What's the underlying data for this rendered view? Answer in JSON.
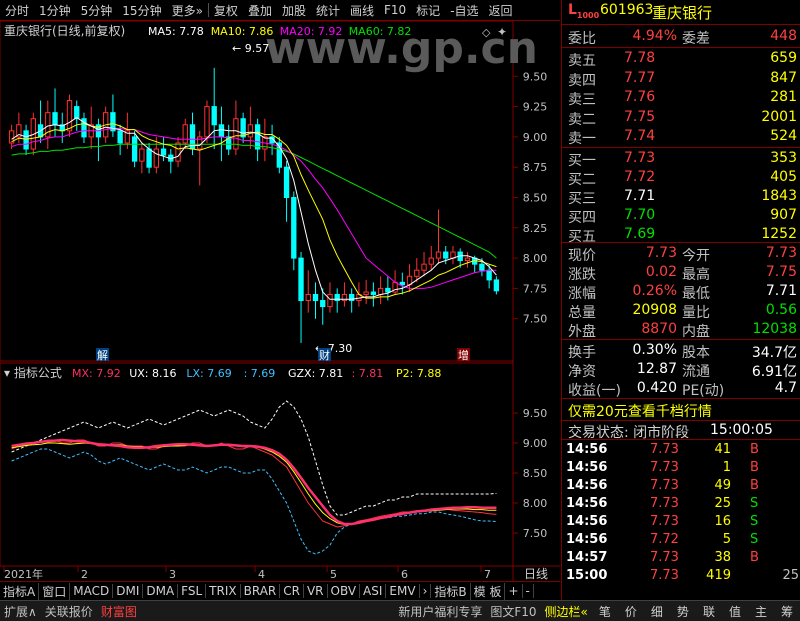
{
  "toolbar": {
    "items": [
      "分时",
      "1分钟",
      "5分钟",
      "15分钟",
      "更多»",
      "复权",
      "叠加",
      "加股",
      "统计",
      "画线",
      "F10",
      "标记",
      "-自选",
      "返回"
    ]
  },
  "main_legend": {
    "title": "重庆银行(日线,前复权)",
    "items": [
      {
        "label": "MA5: 7.78",
        "color": "#ffffff"
      },
      {
        "label": "MA10: 7.86",
        "color": "#ffff00"
      },
      {
        "label": "MA20: 7.92",
        "color": "#ff00ff"
      },
      {
        "label": "MA60: 7.82",
        "color": "#00e000"
      }
    ],
    "watermark": "www.gp.cn"
  },
  "main_axis": {
    "ticks": [
      "9.50",
      "9.25",
      "9.00",
      "8.75",
      "8.50",
      "8.25",
      "8.00",
      "7.75",
      "7.50"
    ]
  },
  "annotations": {
    "high": "9.57",
    "low": "7.30",
    "tag_jie": "解",
    "tag_cai": "财",
    "tag_zeng": "增"
  },
  "indicator_legend": {
    "title": "指标公式",
    "items": [
      {
        "label": "MX: 7.92",
        "color": "#ff3060"
      },
      {
        "label": "UX: 8.16",
        "color": "#ffffff"
      },
      {
        "label": "LX: 7.69",
        "color": "#40c0ff"
      },
      {
        "label": ": 7.69",
        "color": "#40c0ff"
      },
      {
        "label": "GZX: 7.81",
        "color": "#ffffff"
      },
      {
        "label": ": 7.81",
        "color": "#ff3060"
      },
      {
        "label": "P2: 7.88",
        "color": "#ffff00"
      }
    ]
  },
  "ind_axis": {
    "ticks": [
      "9.50",
      "9.00",
      "8.50",
      "8.00",
      "7.50"
    ]
  },
  "date_axis": {
    "labels": [
      "2021年",
      "2",
      "3",
      "4",
      "5",
      "6",
      "7"
    ],
    "right": "日线"
  },
  "tabs": [
    "指标A",
    "窗口",
    "MACD",
    "DMI",
    "DMA",
    "FSL",
    "TRIX",
    "BRAR",
    "CR",
    "VR",
    "OBV",
    "ASI",
    "EMV",
    "›",
    "指标B",
    "模 板",
    "+",
    "-"
  ],
  "bottom": {
    "left": [
      {
        "t": "扩展∧",
        "c": "#c0c0c0"
      },
      {
        "t": "关联报价",
        "c": "#c0c0c0"
      },
      {
        "t": "财富图",
        "c": "#ff4040"
      }
    ],
    "mid": [
      {
        "t": "新用户福利专享",
        "c": "#c0c0c0"
      },
      {
        "t": "图文F10",
        "c": "#c0c0c0"
      },
      {
        "t": "侧边栏«",
        "c": "#ffff00"
      }
    ],
    "right": [
      "笔",
      "价",
      "细",
      "势",
      "联",
      "值",
      "主",
      "筹"
    ]
  },
  "quote": {
    "code": "601963",
    "name": "重庆银行",
    "mark": "L",
    "mark_sub": "1000",
    "webi_label": "委比",
    "webi": "4.94%",
    "weicha_label": "委差",
    "weicha": "448",
    "sells": [
      {
        "label": "卖五",
        "price": "7.78",
        "vol": "659"
      },
      {
        "label": "卖四",
        "price": "7.77",
        "vol": "847"
      },
      {
        "label": "卖三",
        "price": "7.76",
        "vol": "281"
      },
      {
        "label": "卖二",
        "price": "7.75",
        "vol": "2001"
      },
      {
        "label": "卖一",
        "price": "7.74",
        "vol": "524"
      }
    ],
    "buys": [
      {
        "label": "买一",
        "price": "7.73",
        "vol": "353",
        "pc": "#ff4040"
      },
      {
        "label": "买二",
        "price": "7.72",
        "vol": "405",
        "pc": "#ff4040"
      },
      {
        "label": "买三",
        "price": "7.71",
        "vol": "1843",
        "pc": "#ffffff"
      },
      {
        "label": "买四",
        "price": "7.70",
        "vol": "907",
        "pc": "#00e000"
      },
      {
        "label": "买五",
        "price": "7.69",
        "vol": "1252",
        "pc": "#00e000"
      }
    ],
    "stats": [
      {
        "l1": "现价",
        "v1": "7.73",
        "c1": "#ff4040",
        "l2": "今开",
        "v2": "7.73",
        "c2": "#ff4040"
      },
      {
        "l1": "涨跌",
        "v1": "0.02",
        "c1": "#ff4040",
        "l2": "最高",
        "v2": "7.75",
        "c2": "#ff4040"
      },
      {
        "l1": "涨幅",
        "v1": "0.26%",
        "c1": "#ff4040",
        "l2": "最低",
        "v2": "7.71",
        "c2": "#ffffff"
      },
      {
        "l1": "总量",
        "v1": "20908",
        "c1": "#ffff00",
        "l2": "量比",
        "v2": "0.56",
        "c2": "#00e000"
      },
      {
        "l1": "外盘",
        "v1": "8870",
        "c1": "#ff4040",
        "l2": "内盘",
        "v2": "12038",
        "c2": "#00e000"
      }
    ],
    "stats2": [
      {
        "l1": "换手",
        "v1": "0.30%",
        "l2": "股本",
        "v2": "34.7亿"
      },
      {
        "l1": "净资",
        "v1": "12.87",
        "l2": "流通",
        "v2": "6.91亿"
      },
      {
        "l1": "收益(一)",
        "v1": "0.420",
        "l2": "PE(动)",
        "v2": "4.7"
      }
    ],
    "promo": "仅需20元查看千档行情",
    "trade_status": "交易状态: 闭市阶段",
    "trade_time": "15:00:05",
    "ticks": [
      {
        "t": "14:56",
        "p": "7.73",
        "v": "41",
        "d": "B"
      },
      {
        "t": "14:56",
        "p": "7.73",
        "v": "1",
        "d": "B"
      },
      {
        "t": "14:56",
        "p": "7.73",
        "v": "49",
        "d": "B"
      },
      {
        "t": "14:56",
        "p": "7.73",
        "v": "25",
        "d": "S"
      },
      {
        "t": "14:56",
        "p": "7.73",
        "v": "16",
        "d": "S"
      },
      {
        "t": "14:56",
        "p": "7.72",
        "v": "5",
        "d": "S"
      },
      {
        "t": "14:57",
        "p": "7.73",
        "v": "38",
        "d": "B"
      },
      {
        "t": "15:00",
        "p": "7.73",
        "v": "419",
        "d": "",
        "x": "25"
      }
    ]
  },
  "chart_data": {
    "type": "candlestick",
    "ylim": [
      7.25,
      9.75
    ],
    "ma_legend": [
      "MA5",
      "MA10",
      "MA20",
      "MA60"
    ],
    "colors": {
      "up": "#ff3030",
      "down": "#00ffff",
      "ma5": "#ffffff",
      "ma10": "#ffff00",
      "ma20": "#ff00ff",
      "ma60": "#00e000"
    },
    "candles": [
      [
        8.95,
        9.05,
        8.9,
        9.1
      ],
      [
        9.0,
        9.1,
        8.95,
        9.2
      ],
      [
        9.05,
        8.9,
        8.85,
        9.1
      ],
      [
        8.9,
        9.15,
        8.85,
        9.2
      ],
      [
        9.1,
        9.0,
        8.95,
        9.3
      ],
      [
        9.0,
        9.2,
        8.9,
        9.3
      ],
      [
        9.2,
        9.1,
        9.0,
        9.4
      ],
      [
        9.1,
        9.05,
        8.95,
        9.2
      ],
      [
        9.05,
        9.3,
        9.0,
        9.35
      ],
      [
        9.25,
        9.15,
        9.05,
        9.3
      ],
      [
        9.15,
        9.0,
        8.95,
        9.2
      ],
      [
        9.0,
        9.1,
        8.9,
        9.25
      ],
      [
        9.1,
        9.0,
        8.8,
        9.15
      ],
      [
        9.0,
        9.2,
        8.95,
        9.25
      ],
      [
        9.2,
        9.05,
        9.0,
        9.35
      ],
      [
        9.05,
        8.95,
        8.85,
        9.1
      ],
      [
        8.95,
        9.05,
        8.9,
        9.2
      ],
      [
        9.0,
        8.8,
        8.75,
        9.05
      ],
      [
        8.8,
        8.9,
        8.7,
        8.95
      ],
      [
        8.9,
        8.75,
        8.7,
        8.95
      ],
      [
        8.75,
        8.9,
        8.7,
        9.0
      ],
      [
        8.9,
        8.85,
        8.8,
        9.0
      ],
      [
        8.85,
        8.8,
        8.7,
        8.9
      ],
      [
        8.8,
        8.95,
        8.75,
        9.0
      ],
      [
        8.95,
        9.1,
        8.9,
        9.15
      ],
      [
        9.1,
        8.9,
        8.85,
        9.2
      ],
      [
        8.9,
        9.0,
        8.6,
        9.05
      ],
      [
        9.0,
        9.25,
        8.95,
        9.3
      ],
      [
        9.25,
        9.1,
        8.9,
        9.57
      ],
      [
        9.1,
        9.0,
        8.8,
        9.25
      ],
      [
        9.0,
        8.9,
        8.85,
        9.1
      ],
      [
        8.9,
        9.15,
        8.85,
        9.3
      ],
      [
        9.15,
        9.0,
        8.95,
        9.2
      ],
      [
        9.0,
        9.1,
        8.9,
        9.25
      ],
      [
        9.1,
        8.9,
        8.8,
        9.15
      ],
      [
        8.9,
        9.0,
        8.8,
        9.15
      ],
      [
        9.0,
        8.95,
        8.85,
        9.1
      ],
      [
        8.95,
        8.75,
        8.7,
        9.0
      ],
      [
        8.75,
        8.5,
        8.3,
        8.8
      ],
      [
        8.5,
        8.0,
        7.9,
        8.55
      ],
      [
        8.0,
        7.65,
        7.3,
        8.05
      ],
      [
        7.65,
        7.7,
        7.55,
        7.9
      ],
      [
        7.7,
        7.65,
        7.5,
        7.8
      ],
      [
        7.65,
        7.6,
        7.45,
        7.75
      ],
      [
        7.6,
        7.7,
        7.55,
        7.8
      ],
      [
        7.7,
        7.65,
        7.55,
        7.75
      ],
      [
        7.65,
        7.7,
        7.6,
        7.8
      ],
      [
        7.7,
        7.65,
        7.55,
        7.75
      ],
      [
        7.65,
        7.7,
        7.6,
        7.8
      ],
      [
        7.7,
        7.72,
        7.62,
        7.82
      ],
      [
        7.72,
        7.7,
        7.6,
        7.8
      ],
      [
        7.7,
        7.75,
        7.62,
        7.85
      ],
      [
        7.75,
        7.72,
        7.65,
        7.85
      ],
      [
        7.72,
        7.8,
        7.7,
        7.9
      ],
      [
        7.8,
        7.78,
        7.7,
        7.88
      ],
      [
        7.78,
        7.85,
        7.72,
        7.95
      ],
      [
        7.85,
        7.9,
        7.8,
        8.0
      ],
      [
        7.9,
        7.95,
        7.85,
        8.05
      ],
      [
        7.95,
        8.0,
        7.9,
        8.1
      ],
      [
        8.0,
        8.05,
        7.95,
        8.4
      ],
      [
        8.05,
        8.0,
        7.95,
        8.1
      ],
      [
        8.0,
        8.05,
        7.95,
        8.1
      ],
      [
        8.05,
        7.98,
        7.92,
        8.08
      ],
      [
        7.98,
        8.0,
        7.92,
        8.05
      ],
      [
        8.0,
        7.95,
        7.88,
        8.02
      ],
      [
        7.95,
        7.9,
        7.85,
        8.0
      ],
      [
        7.9,
        7.82,
        7.75,
        7.95
      ],
      [
        7.82,
        7.73,
        7.7,
        7.85
      ]
    ],
    "ma5": [
      8.98,
      9.02,
      9.0,
      9.02,
      9.05,
      9.09,
      9.1,
      9.09,
      9.12,
      9.16,
      9.12,
      9.09,
      9.06,
      9.08,
      9.07,
      9.06,
      9.03,
      9.03,
      8.95,
      8.9,
      8.86,
      8.84,
      8.82,
      8.84,
      8.92,
      8.93,
      8.93,
      8.99,
      9.05,
      9.06,
      9.05,
      9.05,
      9.03,
      9.04,
      9.03,
      8.99,
      8.99,
      8.92,
      8.82,
      8.64,
      8.38,
      8.12,
      7.9,
      7.72,
      7.66,
      7.66,
      7.66,
      7.66,
      7.67,
      7.68,
      7.68,
      7.7,
      7.71,
      7.74,
      7.75,
      7.78,
      7.82,
      7.86,
      7.9,
      7.96,
      7.98,
      8.0,
      8.02,
      8.02,
      8.0,
      7.98,
      7.93,
      7.86
    ],
    "ma10": [
      8.96,
      8.99,
      8.98,
      8.99,
      9.0,
      9.04,
      9.06,
      9.05,
      9.07,
      9.1,
      9.11,
      9.09,
      9.08,
      9.1,
      9.11,
      9.09,
      9.06,
      9.06,
      9.01,
      8.98,
      8.96,
      8.94,
      8.93,
      8.9,
      8.91,
      8.9,
      8.89,
      8.91,
      8.93,
      8.95,
      8.99,
      9.01,
      9.01,
      9.03,
      9.04,
      9.02,
      9.02,
      8.98,
      8.93,
      8.84,
      8.69,
      8.56,
      8.44,
      8.32,
      8.15,
      8.02,
      7.91,
      7.8,
      7.7,
      7.67,
      7.67,
      7.68,
      7.68,
      7.7,
      7.71,
      7.73,
      7.76,
      7.79,
      7.82,
      7.86,
      7.88,
      7.91,
      7.94,
      7.96,
      7.98,
      7.97,
      7.95,
      7.93
    ],
    "ma20": [
      8.92,
      8.94,
      8.94,
      8.96,
      8.97,
      8.99,
      9.0,
      9.0,
      9.02,
      9.04,
      9.05,
      9.05,
      9.05,
      9.06,
      9.07,
      9.07,
      9.06,
      9.06,
      9.04,
      9.02,
      9.01,
      9.0,
      8.99,
      8.98,
      8.98,
      8.98,
      8.98,
      8.99,
      9.0,
      9.0,
      8.99,
      8.99,
      8.97,
      8.97,
      8.96,
      8.95,
      8.94,
      8.92,
      8.89,
      8.85,
      8.8,
      8.73,
      8.65,
      8.58,
      8.49,
      8.4,
      8.3,
      8.2,
      8.1,
      8.0,
      7.95,
      7.9,
      7.85,
      7.8,
      7.77,
      7.75,
      7.75,
      7.75,
      7.76,
      7.78,
      7.8,
      7.82,
      7.84,
      7.86,
      7.88,
      7.89,
      7.9,
      7.9
    ],
    "ma60": [
      8.85,
      8.86,
      8.86,
      8.87,
      8.88,
      8.88,
      8.89,
      8.89,
      8.9,
      8.91,
      8.91,
      8.92,
      8.92,
      8.93,
      8.93,
      8.94,
      8.94,
      8.94,
      8.94,
      8.94,
      8.94,
      8.94,
      8.94,
      8.94,
      8.94,
      8.94,
      8.94,
      8.94,
      8.94,
      8.94,
      8.94,
      8.94,
      8.93,
      8.93,
      8.92,
      8.92,
      8.91,
      8.9,
      8.88,
      8.86,
      8.83,
      8.8,
      8.77,
      8.74,
      8.71,
      8.68,
      8.65,
      8.62,
      8.59,
      8.56,
      8.53,
      8.5,
      8.47,
      8.44,
      8.41,
      8.38,
      8.35,
      8.32,
      8.29,
      8.26,
      8.23,
      8.2,
      8.17,
      8.14,
      8.11,
      8.08,
      8.05,
      8.0
    ],
    "indicator": {
      "ylim": [
        7.0,
        10.0
      ],
      "ux": [
        8.85,
        8.9,
        8.95,
        9.0,
        9.05,
        9.1,
        9.15,
        9.2,
        9.25,
        9.3,
        9.35,
        9.3,
        9.25,
        9.3,
        9.35,
        9.3,
        9.25,
        9.3,
        9.35,
        9.4,
        9.35,
        9.3,
        9.35,
        9.4,
        9.45,
        9.5,
        9.55,
        9.5,
        9.45,
        9.5,
        9.55,
        9.5,
        9.45,
        9.35,
        9.3,
        9.25,
        9.4,
        9.6,
        9.7,
        9.6,
        9.4,
        9.1,
        8.7,
        8.3,
        7.95,
        7.8,
        7.8,
        7.85,
        7.9,
        7.95,
        7.95,
        8.0,
        8.05,
        8.05,
        8.1,
        8.1,
        8.15,
        8.15,
        8.15,
        8.15,
        8.15,
        8.15,
        8.15,
        8.15,
        8.15,
        8.15,
        8.15,
        8.16
      ],
      "lx": [
        8.7,
        8.75,
        8.8,
        8.85,
        8.9,
        8.9,
        8.85,
        8.8,
        8.75,
        8.8,
        8.85,
        8.8,
        8.7,
        8.65,
        8.7,
        8.75,
        8.7,
        8.65,
        8.6,
        8.55,
        8.6,
        8.65,
        8.6,
        8.55,
        8.55,
        8.6,
        8.55,
        8.5,
        8.55,
        8.6,
        8.6,
        8.55,
        8.5,
        8.5,
        8.55,
        8.55,
        8.4,
        8.2,
        8.0,
        7.7,
        7.4,
        7.2,
        7.15,
        7.2,
        7.3,
        7.5,
        7.6,
        7.65,
        7.7,
        7.7,
        7.72,
        7.75,
        7.75,
        7.78,
        7.78,
        7.8,
        7.82,
        7.82,
        7.85,
        7.85,
        7.82,
        7.8,
        7.78,
        7.75,
        7.72,
        7.7,
        7.7,
        7.69
      ],
      "mx": [
        8.95,
        8.97,
        8.99,
        9.0,
        9.02,
        9.03,
        9.04,
        9.05,
        9.04,
        9.03,
        9.02,
        9.0,
        8.98,
        8.97,
        8.96,
        8.95,
        8.93,
        8.92,
        8.92,
        8.93,
        8.95,
        8.96,
        8.97,
        8.98,
        8.98,
        8.97,
        8.96,
        8.95,
        8.96,
        8.97,
        8.97,
        8.96,
        8.95,
        8.95,
        8.94,
        8.92,
        8.88,
        8.82,
        8.72,
        8.58,
        8.42,
        8.25,
        8.1,
        7.95,
        7.8,
        7.7,
        7.65,
        7.65,
        7.67,
        7.7,
        7.72,
        7.75,
        7.77,
        7.8,
        7.82,
        7.84,
        7.86,
        7.87,
        7.89,
        7.9,
        7.91,
        7.92,
        7.92,
        7.93,
        7.93,
        7.92,
        7.92,
        7.92
      ],
      "gzx": [
        8.9,
        8.95,
        9.0,
        9.0,
        9.02,
        9.05,
        9.05,
        9.0,
        9.0,
        9.05,
        9.05,
        9.0,
        8.95,
        8.95,
        9.0,
        9.0,
        8.95,
        8.95,
        8.95,
        8.9,
        8.9,
        8.95,
        8.95,
        8.95,
        8.95,
        9.0,
        9.0,
        8.95,
        8.95,
        9.0,
        8.95,
        8.9,
        8.9,
        8.95,
        8.9,
        8.85,
        8.8,
        8.7,
        8.6,
        8.4,
        8.2,
        8.0,
        7.85,
        7.7,
        7.65,
        7.6,
        7.62,
        7.65,
        7.7,
        7.72,
        7.75,
        7.78,
        7.8,
        7.82,
        7.85,
        7.85,
        7.87,
        7.88,
        7.88,
        7.9,
        7.9,
        7.88,
        7.87,
        7.86,
        7.85,
        7.84,
        7.82,
        7.81
      ],
      "p2": [
        8.92,
        8.94,
        8.96,
        8.97,
        8.98,
        9.0,
        9.0,
        8.99,
        8.98,
        8.99,
        9.0,
        8.99,
        8.97,
        8.96,
        8.97,
        8.97,
        8.95,
        8.94,
        8.94,
        8.93,
        8.93,
        8.94,
        8.95,
        8.95,
        8.96,
        8.97,
        8.97,
        8.96,
        8.96,
        8.97,
        8.96,
        8.95,
        8.94,
        8.94,
        8.93,
        8.9,
        8.85,
        8.78,
        8.68,
        8.52,
        8.34,
        8.15,
        7.98,
        7.84,
        7.74,
        7.67,
        7.64,
        7.65,
        7.68,
        7.71,
        7.73,
        7.76,
        7.78,
        7.8,
        7.82,
        7.84,
        7.85,
        7.86,
        7.87,
        7.88,
        7.89,
        7.9,
        7.9,
        7.9,
        7.89,
        7.89,
        7.88,
        7.88
      ]
    }
  }
}
